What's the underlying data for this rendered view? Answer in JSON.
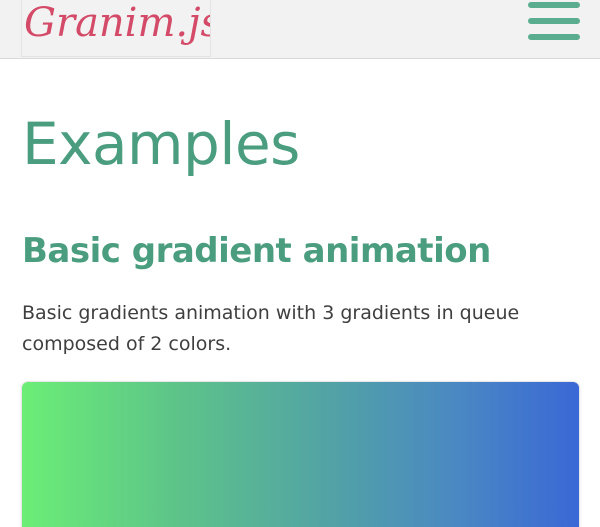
{
  "header": {
    "logo_text": "Granim.js",
    "logo_colors": [
      "#d94b6a",
      "#c23a5c"
    ],
    "menu_icon": "hamburger-menu-icon",
    "menu_color": "#5aad8f"
  },
  "main": {
    "title": "Examples",
    "section_title": "Basic gradient animation",
    "description": "Basic gradients animation with 3 gradients in queue composed of 2 colors.",
    "gradient_colors": [
      "#6bee76",
      "#3a68d6"
    ]
  }
}
